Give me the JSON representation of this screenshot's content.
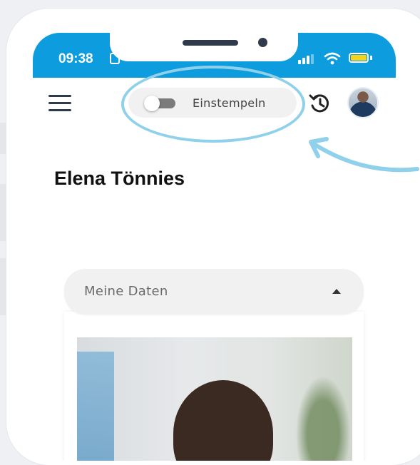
{
  "status_bar": {
    "time": "09:38"
  },
  "app_bar": {
    "clock_in_label": "Einstempeln",
    "clock_in_state": "off"
  },
  "profile": {
    "name": "Elena Tönnies"
  },
  "section": {
    "title": "Meine Daten",
    "expanded": true
  },
  "colors": {
    "status_bar": "#0d9ddf",
    "annotation": "#8fd0ea",
    "battery": "#f5d21b"
  },
  "icons": {
    "menu": "hamburger-menu-icon",
    "history": "history-icon",
    "caret": "caret-up-icon"
  }
}
